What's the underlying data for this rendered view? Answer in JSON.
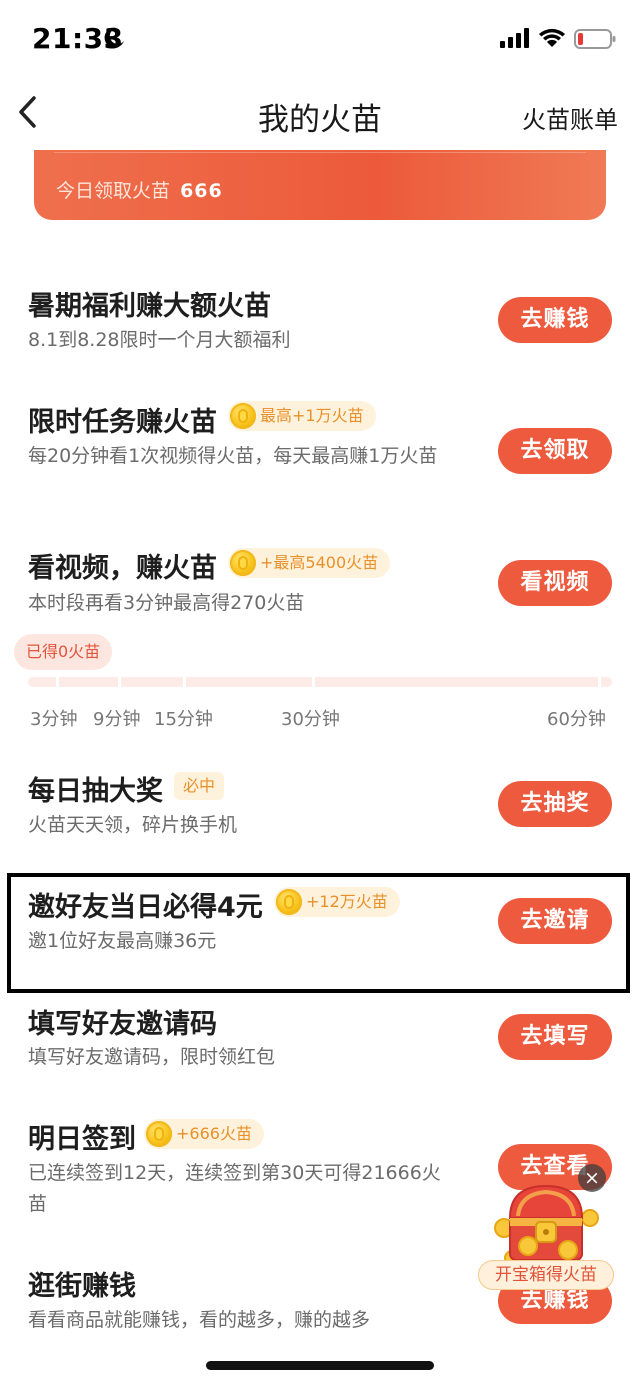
{
  "status_bar": {
    "time": "21:33"
  },
  "nav": {
    "title": "我的火苗",
    "right_link": "火苗账单"
  },
  "banner": {
    "label": "今日领取火苗",
    "value": "666"
  },
  "tasks": [
    {
      "title": "暑期福利赚大额火苗",
      "desc": "8.1到8.28限时一个月大额福利",
      "button": "去赚钱"
    },
    {
      "title": "限时任务赚火苗",
      "badge": "最高+1万火苗",
      "desc": "每20分钟看1次视频得火苗，每天最高赚1万火苗",
      "button": "去领取"
    },
    {
      "title": "看视频，赚火苗",
      "badge": "+最高5400火苗",
      "desc": "本时段再看3分钟最高得270火苗",
      "button": "看视频"
    },
    {
      "title": "每日抽大奖",
      "tag": "必中",
      "desc": "火苗天天领，碎片换手机",
      "button": "去抽奖"
    },
    {
      "title": "邀好友当日必得4元",
      "badge": "+12万火苗",
      "desc": "邀1位好友最高赚36元",
      "button": "去邀请"
    },
    {
      "title": "填写好友邀请码",
      "desc": "填写好友邀请码，限时领红包",
      "button": "去填写"
    },
    {
      "title": "明日签到",
      "badge": "+666火苗",
      "desc": "已连续签到12天，连续签到第30天可得21666火苗",
      "button": "去查看"
    },
    {
      "title": "逛街赚钱",
      "desc": "看看商品就能赚钱，看的越多，赚的越多",
      "button": "去赚钱"
    }
  ],
  "video_progress": {
    "earned": "已得0火苗",
    "progress_fraction": 0,
    "ticks": [
      "3分钟",
      "9分钟",
      "15分钟",
      "30分钟",
      "60分钟"
    ]
  },
  "treasure": {
    "label": "开宝箱得火苗",
    "close": "×"
  },
  "colors": {
    "accent": "#ed5a3e",
    "badge_bg": "#fff2dc",
    "badge_text": "#e8902a"
  }
}
